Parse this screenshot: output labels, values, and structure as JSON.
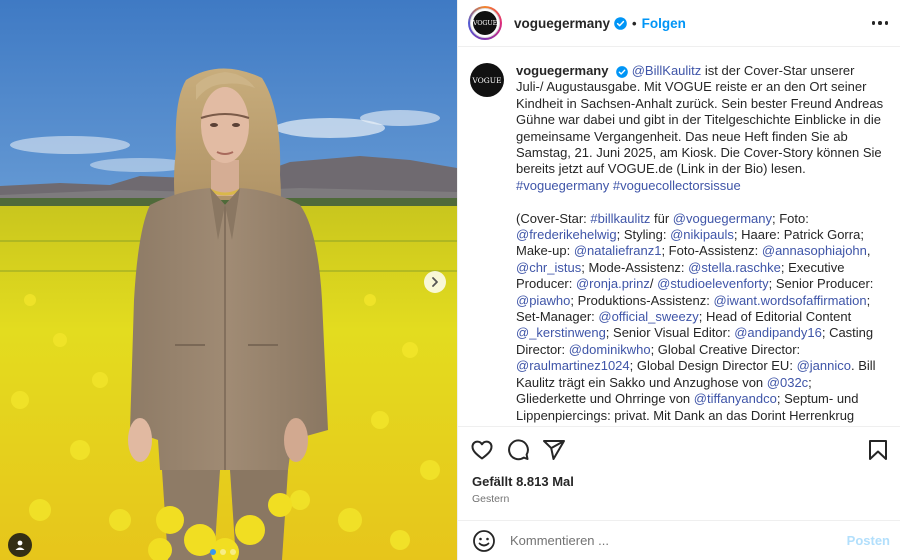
{
  "post": {
    "username": "voguegermany",
    "follow_label": "Folgen",
    "separator": "•",
    "avatar_text": "VOGUE",
    "likes_text": "Gefällt 8.813 Mal",
    "date_text": "Gestern"
  },
  "caption": {
    "user": "voguegermany",
    "para1": [
      {
        "t": "m",
        "v": "@BillKaulitz"
      },
      {
        "t": "x",
        "v": " ist der Cover-Star unserer Juli-/ Augustausgabe. Mit VOGUE reiste er an den Ort seiner Kindheit in Sachsen-Anhalt zurück. Sein bester Freund Andreas Gühne war dabei und gibt in der Titelgeschichte Einblicke in die gemeinsame Vergangenheit. Das neue Heft finden Sie ab Samstag, 21. Juni 2025, am Kiosk. Die Cover-Story können Sie bereits jetzt auf VOGUE.de (Link in der Bio) lesen. "
      },
      {
        "t": "m",
        "v": "#voguegermany"
      },
      {
        "t": "x",
        "v": " "
      },
      {
        "t": "m",
        "v": "#voguecollectorsissue"
      }
    ],
    "para2": [
      {
        "t": "x",
        "v": "(Cover-Star: "
      },
      {
        "t": "m",
        "v": "#billkaulitz"
      },
      {
        "t": "x",
        "v": " für "
      },
      {
        "t": "m",
        "v": "@voguegermany"
      },
      {
        "t": "x",
        "v": "; Foto: "
      },
      {
        "t": "m",
        "v": "@frederikehelwig"
      },
      {
        "t": "x",
        "v": "; Styling: "
      },
      {
        "t": "m",
        "v": "@nikipauls"
      },
      {
        "t": "x",
        "v": "; Haare: Patrick Gorra; Make-up: "
      },
      {
        "t": "m",
        "v": "@nataliefranz1"
      },
      {
        "t": "x",
        "v": "; Foto-Assistenz: "
      },
      {
        "t": "m",
        "v": "@annasophiajohn"
      },
      {
        "t": "x",
        "v": ", "
      },
      {
        "t": "m",
        "v": "@chr_istus"
      },
      {
        "t": "x",
        "v": "; Mode-Assistenz: "
      },
      {
        "t": "m",
        "v": "@stella.raschke"
      },
      {
        "t": "x",
        "v": "; Executive Producer: "
      },
      {
        "t": "m",
        "v": "@ronja.prinz"
      },
      {
        "t": "x",
        "v": "/ "
      },
      {
        "t": "m",
        "v": "@studioelevenforty"
      },
      {
        "t": "x",
        "v": "; Senior Producer: "
      },
      {
        "t": "m",
        "v": "@piawho"
      },
      {
        "t": "x",
        "v": "; Produktions-Assistenz: "
      },
      {
        "t": "m",
        "v": "@iwant.wordsofaffirmation"
      },
      {
        "t": "x",
        "v": "; Set-Manager: "
      },
      {
        "t": "m",
        "v": "@official_sweezy"
      },
      {
        "t": "x",
        "v": "; Head of Editorial Content "
      },
      {
        "t": "m",
        "v": "@_kerstinweng"
      },
      {
        "t": "x",
        "v": "; Senior Visual Editor: "
      },
      {
        "t": "m",
        "v": "@andipandy16"
      },
      {
        "t": "x",
        "v": "; Casting Director: "
      },
      {
        "t": "m",
        "v": "@dominikwho"
      },
      {
        "t": "x",
        "v": "; Global Creative Director: "
      },
      {
        "t": "m",
        "v": "@raulmartinez1024"
      },
      {
        "t": "x",
        "v": "; Global Design Director EU: "
      },
      {
        "t": "m",
        "v": "@jannico"
      },
      {
        "t": "x",
        "v": ". Bill Kaulitz trägt ein Sakko und Anzughose von "
      },
      {
        "t": "m",
        "v": "@032c"
      },
      {
        "t": "x",
        "v": "; Gliederkette und Ohrringe von "
      },
      {
        "t": "m",
        "v": "@tiffanyandco"
      },
      {
        "t": "x",
        "v": "; Septum- und Lippenpiercings: privat. Mit Dank an das Dorint Herrenkrug Parkhotel Magdeburg und das"
      }
    ]
  },
  "comment_box": {
    "placeholder": "Kommentieren ...",
    "post_label": "Posten"
  },
  "icons": {
    "like": "heart-icon",
    "comment": "comment-icon",
    "share": "share-icon",
    "save": "bookmark-icon",
    "emoji": "emoji-icon",
    "more": "more-options-icon",
    "verified": "verified-badge-icon",
    "next": "chevron-right-icon",
    "tagged": "user-tag-icon"
  },
  "colors": {
    "accent": "#0095f6",
    "mention": "#3f55a8",
    "verified": "#0095f6"
  },
  "carousel": {
    "slides": 3,
    "active": 1
  }
}
